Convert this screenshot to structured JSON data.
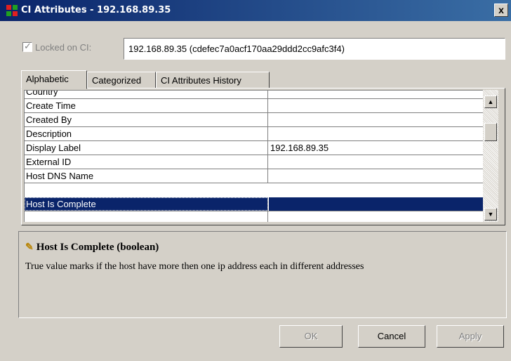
{
  "window": {
    "title": "CI Attributes - 192.168.89.35",
    "close_label": "x"
  },
  "locked": {
    "label": "Locked on CI:",
    "checked": true,
    "value": "192.168.89.35 (cdefec7a0acf170aa29ddd2cc9afc3f4)"
  },
  "tabs": [
    {
      "label": "Alphabetic",
      "active": true
    },
    {
      "label": "Categorized",
      "active": false
    },
    {
      "label": "CI Attributes History",
      "active": false
    }
  ],
  "attributes": [
    {
      "name": "Country",
      "value": ""
    },
    {
      "name": "Create Time",
      "value": ""
    },
    {
      "name": "Created By",
      "value": ""
    },
    {
      "name": "Description",
      "value": ""
    },
    {
      "name": "Display Label",
      "value": "192.168.89.35"
    },
    {
      "name": "External ID",
      "value": ""
    },
    {
      "name": "Host DNS Name",
      "value": ""
    },
    {
      "name": "Host Is Complete",
      "value": "",
      "selected": true
    }
  ],
  "description": {
    "title": "Host Is Complete (boolean)",
    "text": "True value marks if the host have more then one ip address each in different addresses"
  },
  "buttons": {
    "ok": "OK",
    "cancel": "Cancel",
    "apply": "Apply"
  }
}
